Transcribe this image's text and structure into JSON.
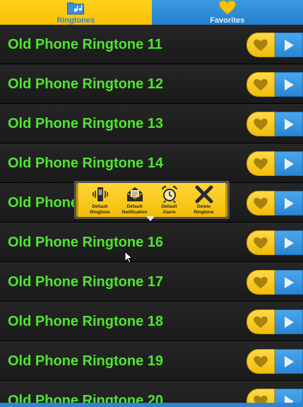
{
  "tabs": [
    {
      "label": "Ringtones",
      "icon": "folder-music-icon",
      "active": true
    },
    {
      "label": "Favorites",
      "icon": "heart-icon",
      "active": false
    }
  ],
  "rows": [
    {
      "title": "Old Phone Ringtone 11"
    },
    {
      "title": "Old Phone Ringtone 12"
    },
    {
      "title": "Old Phone Ringtone 13"
    },
    {
      "title": "Old Phone Ringtone 14"
    },
    {
      "title": "Old Phone"
    },
    {
      "title": "Old Phone Ringtone 16"
    },
    {
      "title": "Old Phone Ringtone 17"
    },
    {
      "title": "Old Phone Ringtone 18"
    },
    {
      "title": "Old Phone Ringtone 19"
    },
    {
      "title": "Old Phone Ringtone 20"
    }
  ],
  "popup": {
    "items": [
      {
        "label_line1": "Default",
        "label_line2": "Ringtone",
        "icon": "vibrating-phone-icon"
      },
      {
        "label_line1": "Default",
        "label_line2": "Notification",
        "icon": "envelope-icon"
      },
      {
        "label_line1": "Default",
        "label_line2": "Alarm",
        "icon": "alarm-clock-icon"
      },
      {
        "label_line1": "Delete",
        "label_line2": "Ringtone",
        "icon": "delete-x-icon"
      }
    ]
  },
  "colors": {
    "accent_yellow": "#f5bf00",
    "accent_blue": "#2a86d4",
    "title_green": "#55e03a",
    "row_background": "#1f1f1f"
  }
}
